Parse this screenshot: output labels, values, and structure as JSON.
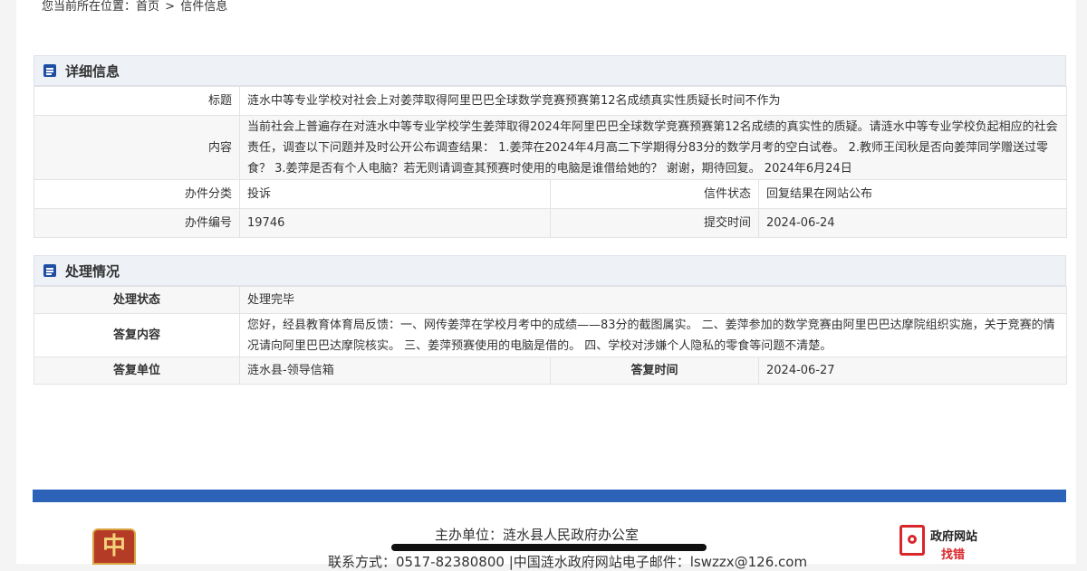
{
  "breadcrumb": {
    "prefix": "您当前所在位置：",
    "home": "首页",
    "separator": ">",
    "current": "信件信息"
  },
  "detail": {
    "section_title": "详细信息",
    "title_label": "标题",
    "title_value": "涟水中等专业学校对社会上对姜萍取得阿里巴巴全球数学竞赛预赛第12名成绩真实性质疑长时间不作为",
    "content_label": "内容",
    "content_value": "当前社会上普遍存在对涟水中等专业学校学生姜萍取得2024年阿里巴巴全球数学竞赛预赛第12名成绩的真实性的质疑。请涟水中等专业学校负起相应的社会责任，调查以下问题并及时公开公布调查结果： 1.姜萍在2024年4月高二下学期得分83分的数学月考的空白试卷。 2.教师王闰秋是否向姜萍同学赠送过零食？ 3.姜萍是否有个人电脑？若无则请调查其预赛时使用的电脑是谁借给她的？ 谢谢，期待回复。 2024年6月24日",
    "category_label": "办件分类",
    "category_value": "投诉",
    "status_label": "信件状态",
    "status_value": "回复结果在网站公布",
    "number_label": "办件编号",
    "number_value": "19746",
    "submit_label": "提交时间",
    "submit_value": "2024-06-24"
  },
  "process": {
    "section_title": "处理情况",
    "state_label": "处理状态",
    "state_value": "处理完毕",
    "reply_label": "答复内容",
    "reply_value": "您好，经县教育体育局反馈：一、网传姜萍在学校月考中的成绩——83分的截图属实。 二、姜萍参加的数学竞赛由阿里巴巴达摩院组织实施，关于竞赛的情况请向阿里巴巴达摩院核实。 三、姜萍预赛使用的电脑是借的。 四、学校对涉嫌个人隐私的零食等问题不清楚。",
    "unit_label": "答复单位",
    "unit_value": "涟水县-领导信箱",
    "time_label": "答复时间",
    "time_value": "2024-06-27"
  },
  "footer": {
    "host": "主办单位：涟水县人民政府办公室",
    "contact": "联系方式：0517-82380800 |中国涟水政府网站电子邮件：lswzzx@126.com",
    "badge_line1": "政府网站",
    "badge_line2": "找错",
    "logo_glyph": "中",
    "logo_icon": "emblem-logo-icon",
    "badge_icon": "search-magnifier-icon",
    "accent_color": "#2c63b8"
  }
}
